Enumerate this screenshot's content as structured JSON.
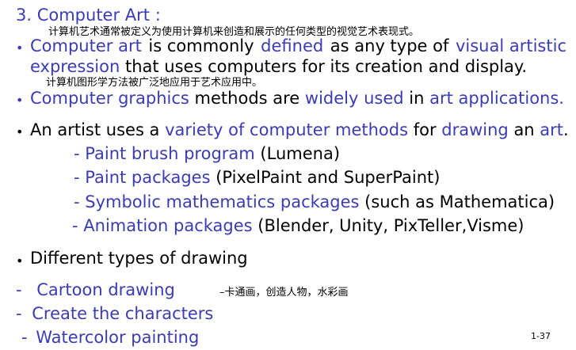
{
  "title": "3. Computer Art :",
  "cn_note_1": "计算机艺术通常被定义为使用计算机来创造和展示的任何类型的视觉艺术表现式。",
  "bullet1": {
    "line1": {
      "a": "Computer art",
      "b": "is commonly",
      "c": "defined",
      "d": "as any type of",
      "e": "visual artistic"
    },
    "line2": {
      "a": "expression",
      "b": " that uses computers for its creation and display."
    }
  },
  "cn_note_2": "计算机图形学方法被广泛地应用于艺术应用中。",
  "bullet2": {
    "a": "Computer graphics",
    "b": " methods are ",
    "c": "widely used",
    "d": " in ",
    "e": "art applications."
  },
  "bullet3": {
    "a": "An artist uses a ",
    "b": "variety of computer methods",
    "c": " for ",
    "d": "drawing",
    "e": " an ",
    "f": "art",
    "g": "."
  },
  "sub_items": [
    {
      "dash": "- ",
      "blue": "Paint brush program",
      "rest": " (Lumena)"
    },
    {
      "dash": "- ",
      "blue": "Paint packages",
      "rest": " (PixelPaint and SuperPaint)"
    },
    {
      "dash": "- ",
      "blue": "Symbolic mathematics packages",
      "rest": " (such as Mathematica)"
    },
    {
      "dash": "- ",
      "blue": "Animation packages",
      "rest": " (Blender, Unity, PixTeller,Visme)"
    }
  ],
  "bullet4": "Different types of drawing",
  "drawing_items": [
    {
      "dash": "- ",
      "label": "Cartoon drawing"
    },
    {
      "dash": "- ",
      "label": "Create the characters"
    },
    {
      "dash": "- ",
      "label": "Watercolor painting"
    }
  ],
  "cn_note_3": "–卡通画，创造人物，水彩画",
  "bullet_glyph": "•",
  "page_number": "1-37"
}
